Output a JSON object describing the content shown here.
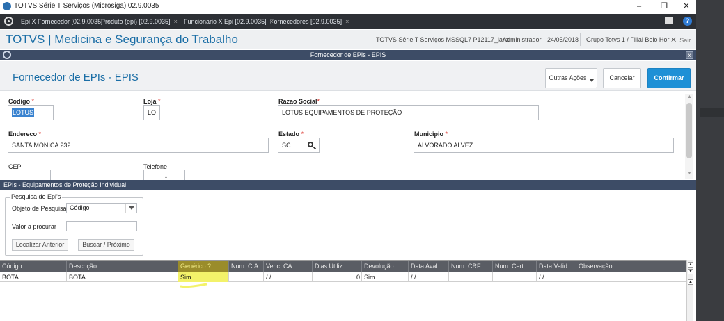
{
  "window": {
    "title": "TOTVS Série T Serviços (Microsiga) 02.9.0035",
    "minimize": "–",
    "maximize": "❐",
    "close": "✕"
  },
  "tabs": [
    {
      "label": "Epi X Fornecedor [02.9.0035]",
      "close": "×"
    },
    {
      "label": "Produto (epi) [02.9.0035]",
      "close": "×"
    },
    {
      "label": "Funcionario X Epi [02.9.0035]",
      "close": "×"
    },
    {
      "label": "Fornecedores [02.9.0035]",
      "close": "×"
    }
  ],
  "header": {
    "brand": "TOTVS | Medicina e Segurança do Trabalho",
    "environment": "TOTVS Série T Serviços MSSQL7 P12117_janx",
    "user": "Administrador",
    "date": "24/05/2018",
    "branch": "Grupo Totvs 1 / Filial Belo Hor",
    "exit": "Sair"
  },
  "dialog": {
    "title": "Fornecedor de EPIs - EPIS",
    "close": "x"
  },
  "form": {
    "title": "Fornecedor de EPIs - EPIS",
    "actions_label": "Outras Ações",
    "cancel_label": "Cancelar",
    "confirm_label": "Confirmar"
  },
  "fields": {
    "codigo": {
      "label": "Codigo",
      "value": "LOTUS"
    },
    "loja": {
      "label": "Loja",
      "value": "LO"
    },
    "razao": {
      "label": "Razao Social",
      "value": "LOTUS EQUIPAMENTOS DE PROTEÇÃO"
    },
    "endereco": {
      "label": "Endereco",
      "value": "SANTA MONICA 232"
    },
    "estado": {
      "label": "Estado",
      "value": "SC"
    },
    "municipio": {
      "label": "Municipio",
      "value": "ALVORADO ALVEZ"
    },
    "cep": {
      "label": "CEP",
      "value": ""
    },
    "telefone": {
      "label": "Telefone",
      "value": "-"
    }
  },
  "required_mark": "*",
  "epis": {
    "section_title": "EPIs  - Equipamentos de Proteção Individual",
    "search": {
      "legend": "Pesquisa de Epi's",
      "object_label": "Objeto de Pesquisa",
      "object_value": "Código",
      "value_label": "Valor a procurar",
      "value": "",
      "prev_button": "Localizar Anterior",
      "next_button": "Buscar / Próximo"
    },
    "columns": [
      "Código",
      "Descrição",
      "Genérico ?",
      "Num. C.A.",
      "Venc. CA",
      "Dias Utiliz.",
      "Devolução",
      "Data Aval.",
      "Num. CRF",
      "Num. Cert.",
      "Data Valid.",
      "Observação"
    ],
    "rows": [
      [
        "BOTA",
        "BOTA",
        "Sim",
        "",
        "/ /",
        "0",
        "Sim",
        "/ /",
        "",
        "",
        "/ /",
        ""
      ]
    ]
  },
  "colors": {
    "brand_blue": "#1b6ea6",
    "confirm_blue": "#1e90d6",
    "dialog_bar": "#3d4c66",
    "highlight_yellow": "#f3f26a"
  }
}
